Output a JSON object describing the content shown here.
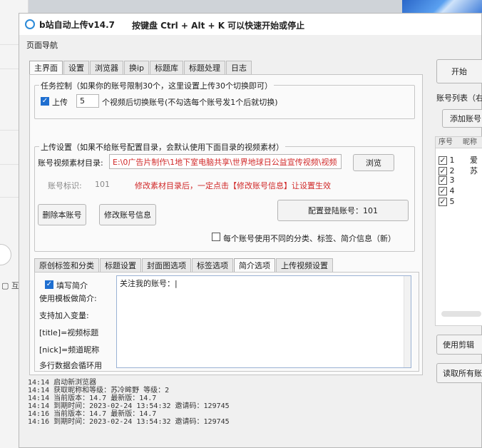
{
  "background": {
    "left_partial_text": "互"
  },
  "window": {
    "title": "b站自动上传v14.7",
    "hotkey_hint": "按键盘 Ctrl + Alt + K  可以快速开始或停止",
    "page_nav": "页面导航"
  },
  "main_tabs": [
    "主界面",
    "设置",
    "浏览器",
    "换ip",
    "标题库",
    "标题处理",
    "日志"
  ],
  "task_control": {
    "legend": "任务控制（如果你的账号限制30个，这里设置上传30个切换即可）",
    "upload_label": "上传",
    "upload_count": "5",
    "switch_text": "个视频后切换账号(不勾选每个账号发1个后就切换)"
  },
  "upload_settings": {
    "legend": "上传设置（如果不给账号配置目录，会默认使用下面目录的视频素材）",
    "folder_label": "账号视频素材目录:",
    "folder_path": "E:\\0广告片制作\\1地下室电脑共享\\世界地球日公益宣传视频\\视频",
    "browse_button": "浏览",
    "account_id_label": "账号标识:",
    "account_id_value": "101",
    "warning": "修改素材目录后，一定点击【修改账号信息】让设置生效",
    "delete_button": "删除本账号",
    "modify_button": "修改账号信息",
    "login_button": "配置登陆账号：101",
    "per_account_checkbox": "每个账号使用不同的分类、标签、简介信息（新）"
  },
  "sub_tabs": [
    "原创标签和分类",
    "标题设置",
    "封面图选项",
    "标签选项",
    "简介选项",
    "上传视频设置"
  ],
  "intro": {
    "fill_label": "填写简介",
    "notes": [
      "使用模板做简介:",
      "支持加入变量:",
      "[title]=视频标题",
      "[nick]=频道昵称",
      "多行数据会循环用"
    ],
    "textarea_value": "关注我的账号：|"
  },
  "log_lines": [
    "14:14  启动新浏览器",
    "14:14  获取昵称和等级：苏冷眸野  等级：2",
    "14:14  当前版本：14.7    最新版：14.7",
    "14:14  到期时间：2023-02-24 13:54:32  邀请码：129745",
    "14:16  当前版本：14.7    最新版：14.7",
    "14:16  到期时间：2023-02-24 13:54:32  邀请码：129745"
  ],
  "right_panel": {
    "start_button": "开始",
    "account_list_label": "账号列表（右",
    "add_account_button": "添加账号",
    "table_headers": [
      "序号",
      "昵称"
    ],
    "rows": [
      {
        "no": "1",
        "name": "爱"
      },
      {
        "no": "2",
        "name": "苏"
      },
      {
        "no": "3",
        "name": ""
      },
      {
        "no": "4",
        "name": ""
      },
      {
        "no": "5",
        "name": ""
      }
    ],
    "edit_button": "使用剪辑",
    "read_all_button": "读取所有账"
  },
  "colors": {
    "accent": "#1f6fd0",
    "warning_text": "#d02828"
  }
}
